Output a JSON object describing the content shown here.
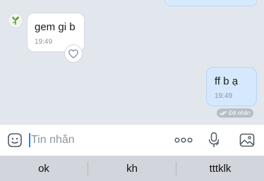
{
  "messages": [
    {
      "direction": "incoming",
      "text": "gem gi b",
      "time": "19:49"
    },
    {
      "direction": "outgoing",
      "text": "ff b ạ",
      "time": "19:49"
    }
  ],
  "status": {
    "label": "Đã nhận"
  },
  "composer": {
    "placeholder": "Tin nhắn"
  },
  "suggestions": [
    "ok",
    "kh",
    "tttklk"
  ],
  "icons": {
    "avatar": "plant-avatar",
    "reaction": "heart-icon",
    "status": "double-check-icon",
    "emoji": "sticker-icon",
    "more": "more-dots-icon",
    "mic": "microphone-icon",
    "image": "image-icon"
  },
  "colors": {
    "outgoing_bubble": "#d5e8fd",
    "incoming_bubble": "#ffffff",
    "chat_background": "#e2e7ed",
    "caret": "#1e88f2",
    "status_pill": "#b7bec5"
  }
}
